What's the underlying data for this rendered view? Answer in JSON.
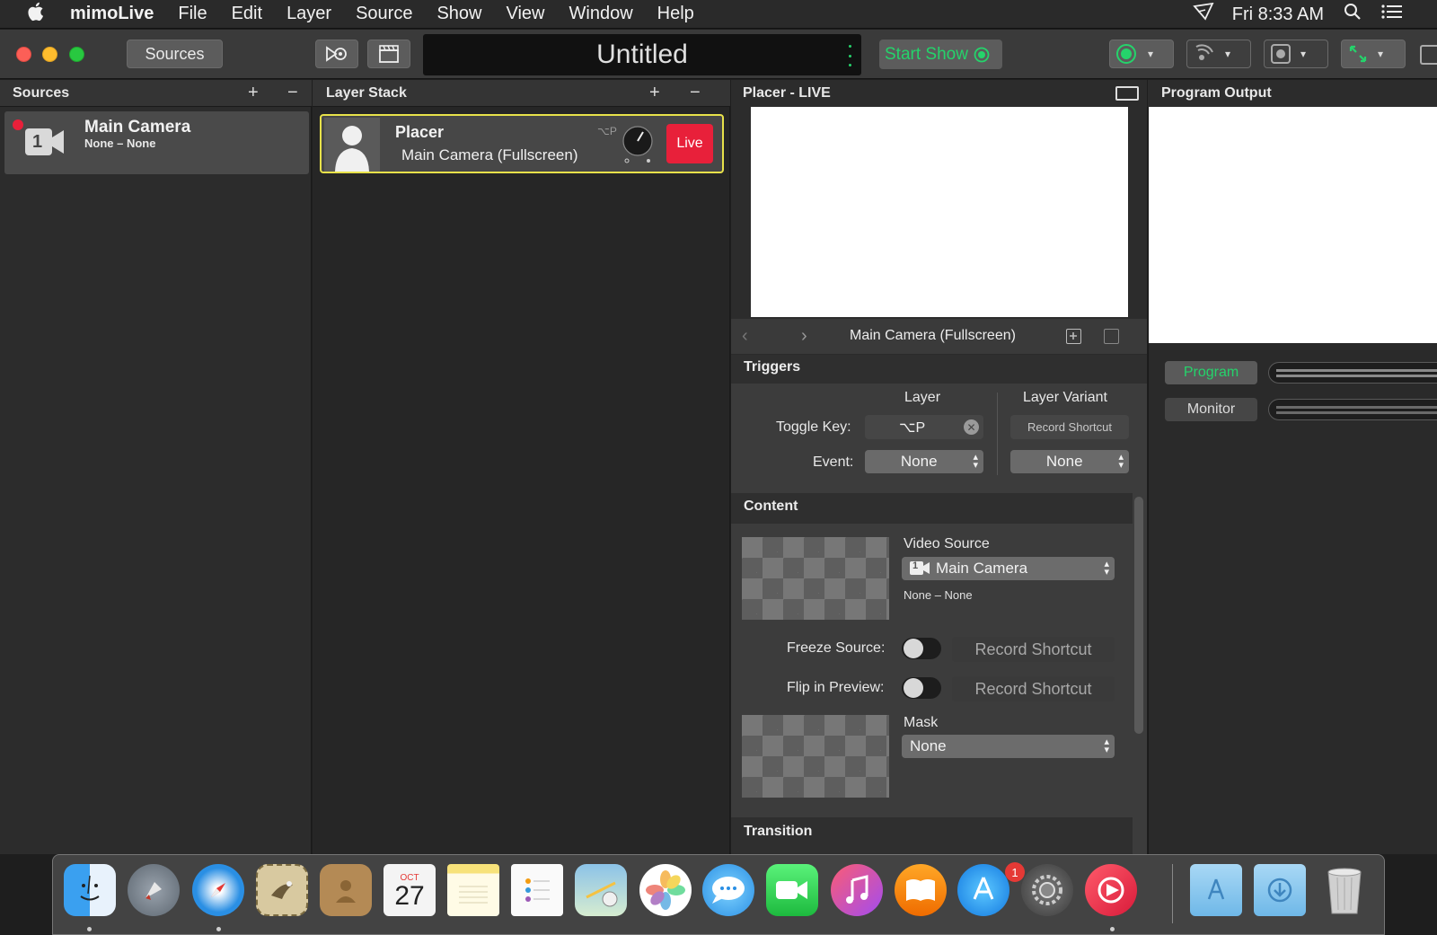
{
  "menubar": {
    "app_name": "mimoLive",
    "items": [
      "File",
      "Edit",
      "Layer",
      "Source",
      "Show",
      "View",
      "Window",
      "Help"
    ],
    "clock": "Fri 8:33 AM"
  },
  "toolbar": {
    "sources_label": "Sources",
    "document_title": "Untitled",
    "start_show_label": "Start Show"
  },
  "sources_panel": {
    "title": "Sources",
    "add": "+",
    "remove": "−",
    "items": [
      {
        "name": "Main Camera",
        "subtitle": "None – None",
        "badge": "1"
      }
    ]
  },
  "layer_stack": {
    "title": "Layer Stack",
    "add": "+",
    "remove": "−",
    "layers": [
      {
        "name": "Placer",
        "variant": "Main Camera (Fullscreen)",
        "shortcut": "⌥P",
        "live_label": "Live"
      }
    ]
  },
  "placer_live": {
    "title": "Placer - LIVE",
    "variant_name": "Main Camera (Fullscreen)",
    "triggers": {
      "heading": "Triggers",
      "col_layer": "Layer",
      "col_variant": "Layer Variant",
      "toggle_key_label": "Toggle Key:",
      "toggle_key_value": "⌥P",
      "record_shortcut_small": "Record Shortcut",
      "event_label": "Event:",
      "event_layer_value": "None",
      "event_variant_value": "None"
    },
    "content": {
      "heading": "Content",
      "video_source_label": "Video Source",
      "video_source_value": "Main Camera",
      "video_source_badge": "1",
      "video_source_sub": "None – None",
      "freeze_label": "Freeze Source:",
      "flip_label": "Flip in Preview:",
      "record_shortcut": "Record Shortcut",
      "mask_label": "Mask",
      "mask_value": "None"
    },
    "transition_heading": "Transition"
  },
  "program_output": {
    "title": "Program Output",
    "program_label": "Program",
    "monitor_label": "Monitor"
  },
  "dock": {
    "calendar_month": "OCT",
    "calendar_day": "27",
    "appstore_badge": "1"
  },
  "colors": {
    "live_red": "#e8203a",
    "go_green": "#25d36b",
    "selection_yellow": "#e8e24a"
  }
}
